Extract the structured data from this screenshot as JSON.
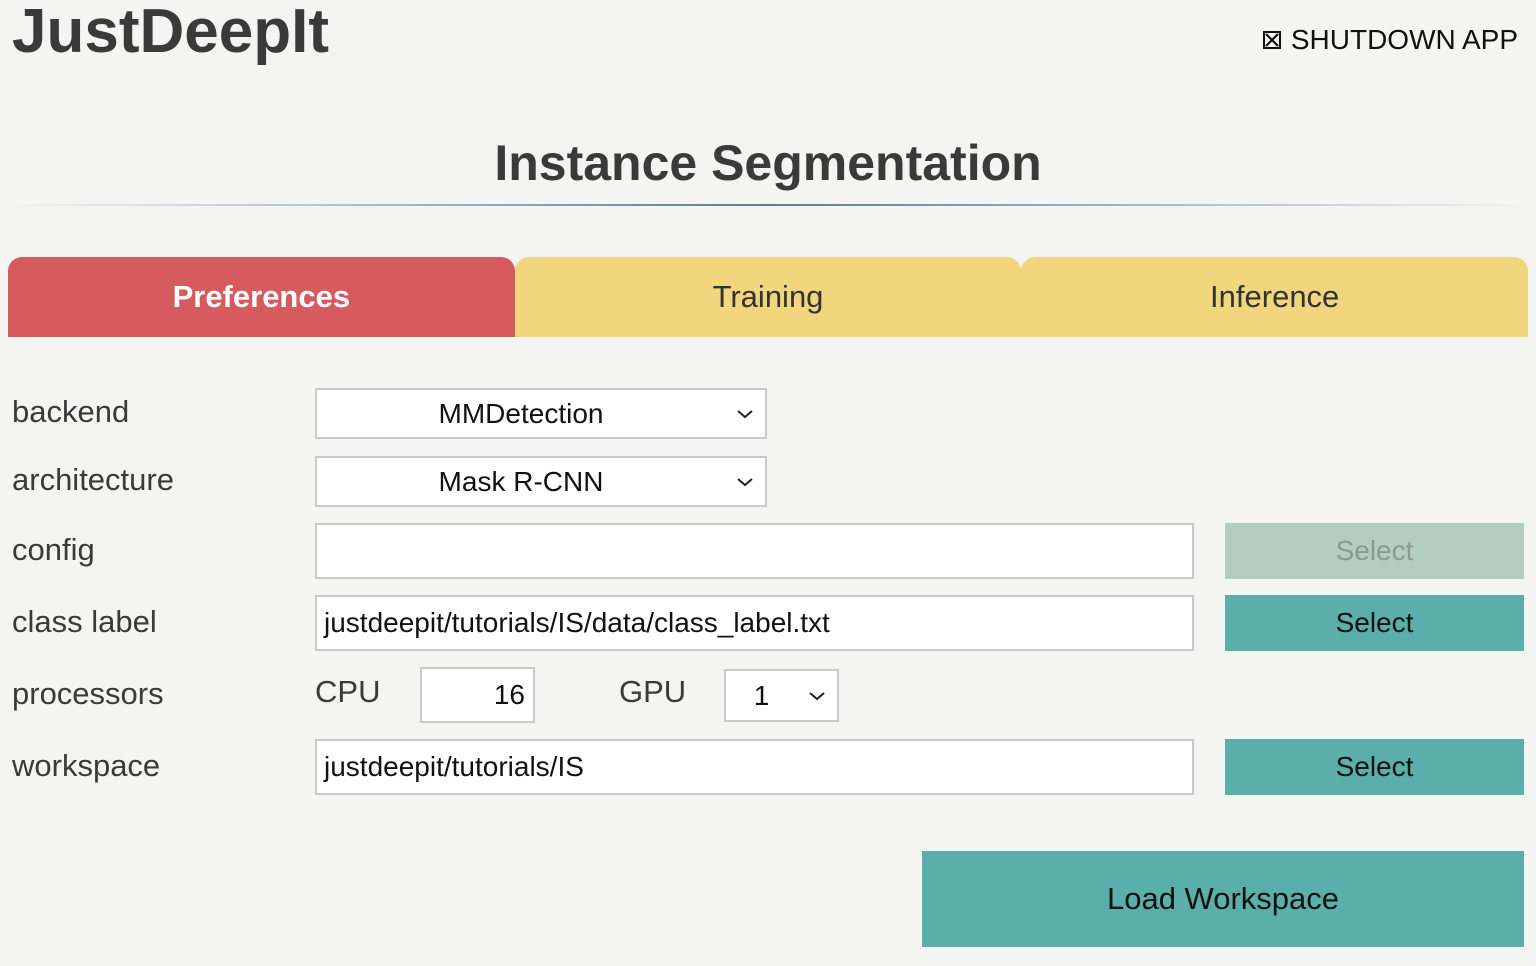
{
  "app": {
    "title": "JustDeepIt",
    "shutdown_label": "SHUTDOWN APP"
  },
  "page": {
    "title": "Instance Segmentation"
  },
  "tabs": [
    {
      "label": "Preferences",
      "active": true
    },
    {
      "label": "Training",
      "active": false
    },
    {
      "label": "Inference",
      "active": false
    }
  ],
  "form": {
    "backend": {
      "label": "backend",
      "value": "MMDetection"
    },
    "architecture": {
      "label": "architecture",
      "value": "Mask R-CNN"
    },
    "config": {
      "label": "config",
      "value": "",
      "button": "Select",
      "button_disabled": true
    },
    "class_label": {
      "label": "class label",
      "value": "justdeepit/tutorials/IS/data/class_label.txt",
      "button": "Select"
    },
    "processors": {
      "label": "processors",
      "cpu_label": "CPU",
      "cpu_value": "16",
      "gpu_label": "GPU",
      "gpu_value": "1"
    },
    "workspace": {
      "label": "workspace",
      "value": "justdeepit/tutorials/IS",
      "button": "Select"
    }
  },
  "actions": {
    "load_workspace": "Load Workspace"
  },
  "colors": {
    "background": "#f4f4f2",
    "tab_active": "#d55b5f",
    "tab_inactive": "#f1d67e",
    "button": "#5bafab",
    "button_disabled": "#b3cdc2"
  },
  "icons": {
    "shutdown": "close-box-icon",
    "dropdown": "chevron-down-icon"
  }
}
